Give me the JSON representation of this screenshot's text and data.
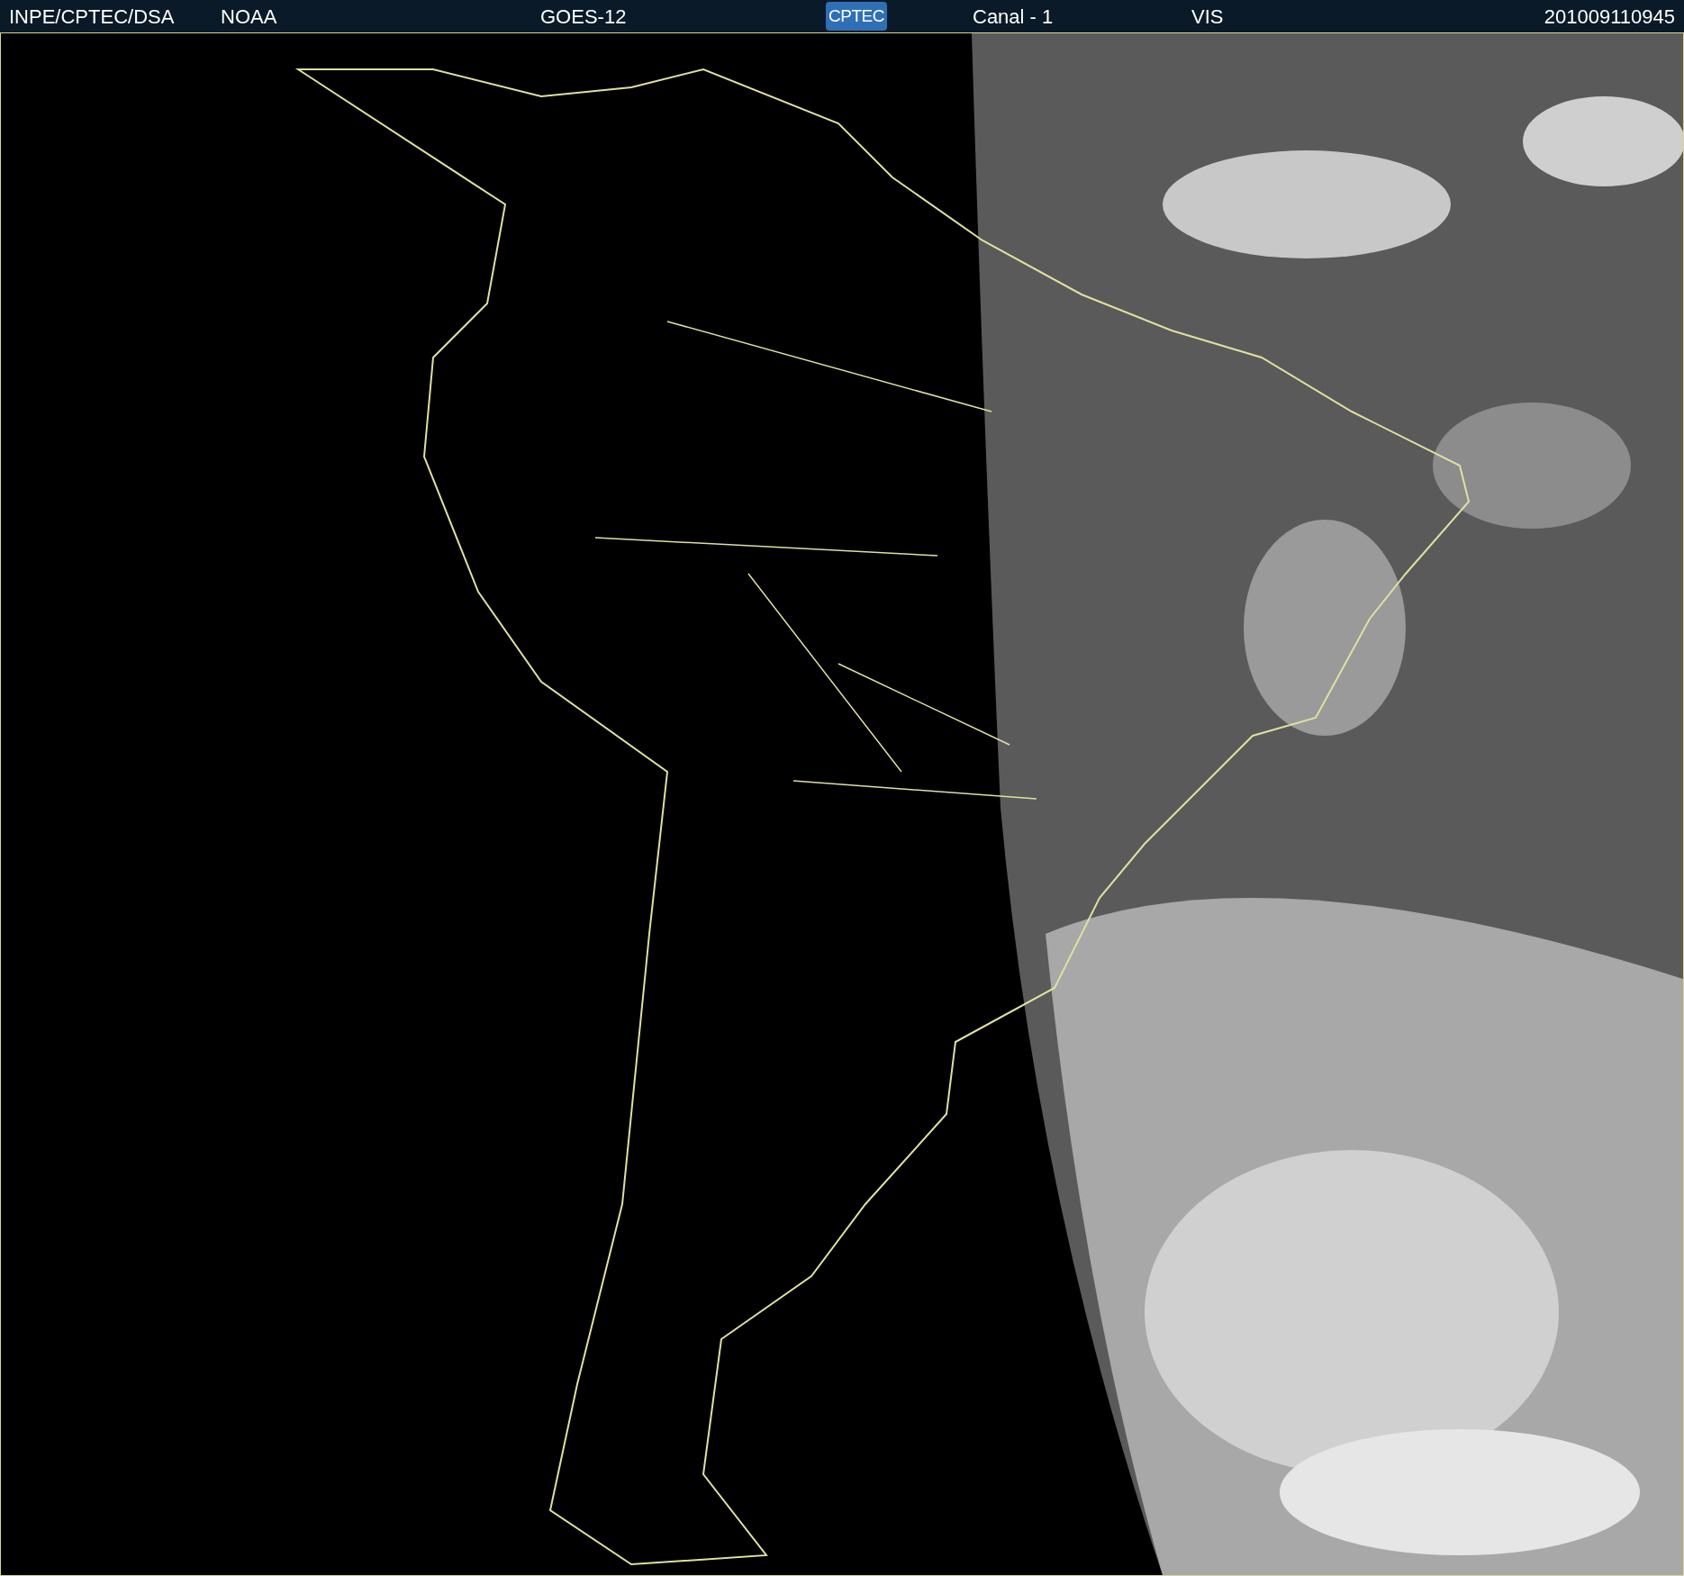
{
  "header": {
    "items": [
      {
        "kind": "text",
        "text": "INPE/CPTEC/DSA"
      },
      {
        "kind": "text",
        "text": "NOAA"
      },
      {
        "kind": "text",
        "text": "GOES-12"
      },
      {
        "kind": "logo",
        "text": "CPTEC"
      },
      {
        "kind": "text",
        "text": "Canal - 1"
      },
      {
        "kind": "text",
        "text": "VIS"
      },
      {
        "kind": "text",
        "text": "201009110945"
      }
    ]
  }
}
